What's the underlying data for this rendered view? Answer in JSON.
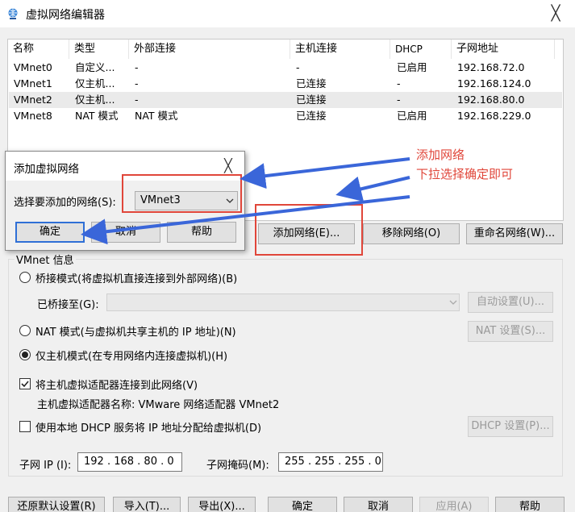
{
  "window": {
    "title": "虚拟网络编辑器",
    "close_glyph": "╳"
  },
  "table": {
    "headers": [
      "名称",
      "类型",
      "外部连接",
      "主机连接",
      "DHCP",
      "子网地址"
    ],
    "rows": [
      {
        "name": "VMnet0",
        "type": "自定义...",
        "external": "-",
        "host": "-",
        "dhcp": "已启用",
        "subnet": "192.168.72.0"
      },
      {
        "name": "VMnet1",
        "type": "仅主机...",
        "external": "-",
        "host": "已连接",
        "dhcp": "-",
        "subnet": "192.168.124.0"
      },
      {
        "name": "VMnet2",
        "type": "仅主机...",
        "external": "-",
        "host": "已连接",
        "dhcp": "-",
        "subnet": "192.168.80.0"
      },
      {
        "name": "VMnet8",
        "type": "NAT 模式",
        "external": "NAT 模式",
        "host": "已连接",
        "dhcp": "已启用",
        "subnet": "192.168.229.0"
      }
    ],
    "selected_row": 2
  },
  "network_buttons": {
    "add": "添加网络(E)...",
    "remove": "移除网络(O)",
    "rename": "重命名网络(W)..."
  },
  "vmnet_info": {
    "legend": "VMnet 信息",
    "bridge_label": "桥接模式(将虚拟机直接连接到外部网络)(B)",
    "bridged_to_label": "已桥接至(G):",
    "auto_settings": "自动设置(U)...",
    "nat_label": "NAT 模式(与虚拟机共享主机的 IP 地址)(N)",
    "nat_settings": "NAT 设置(S)...",
    "hostonly_label": "仅主机模式(在专用网络内连接虚拟机)(H)",
    "selected_mode": "hostonly",
    "connect_adapter_label": "将主机虚拟适配器连接到此网络(V)",
    "connect_adapter_checked": true,
    "adapter_name_label": "主机虚拟适配器名称: VMware 网络适配器 VMnet2",
    "dhcp_label": "使用本地 DHCP 服务将 IP 地址分配给虚拟机(D)",
    "dhcp_checked": false,
    "dhcp_settings": "DHCP 设置(P)...",
    "subnet_ip_label": "子网 IP (I):",
    "subnet_ip": "192 . 168 . 80 . 0",
    "subnet_mask_label": "子网掩码(M):",
    "subnet_mask": "255 . 255 . 255 . 0"
  },
  "footer_buttons": {
    "restore": "还原默认设置(R)",
    "import": "导入(T)...",
    "export": "导出(X)...",
    "ok": "确定",
    "cancel": "取消",
    "apply": "应用(A)",
    "help": "帮助"
  },
  "dialog": {
    "title": "添加虚拟网络",
    "close_glyph": "╳",
    "select_label": "选择要添加的网络(S):",
    "select_value": "VMnet3",
    "ok": "确定",
    "cancel": "取消",
    "help": "帮助"
  },
  "annotation": {
    "line1": "添加网络",
    "line2": "下拉选择确定即可",
    "color": "#e0463a",
    "arrow_color": "#3a66d9"
  }
}
